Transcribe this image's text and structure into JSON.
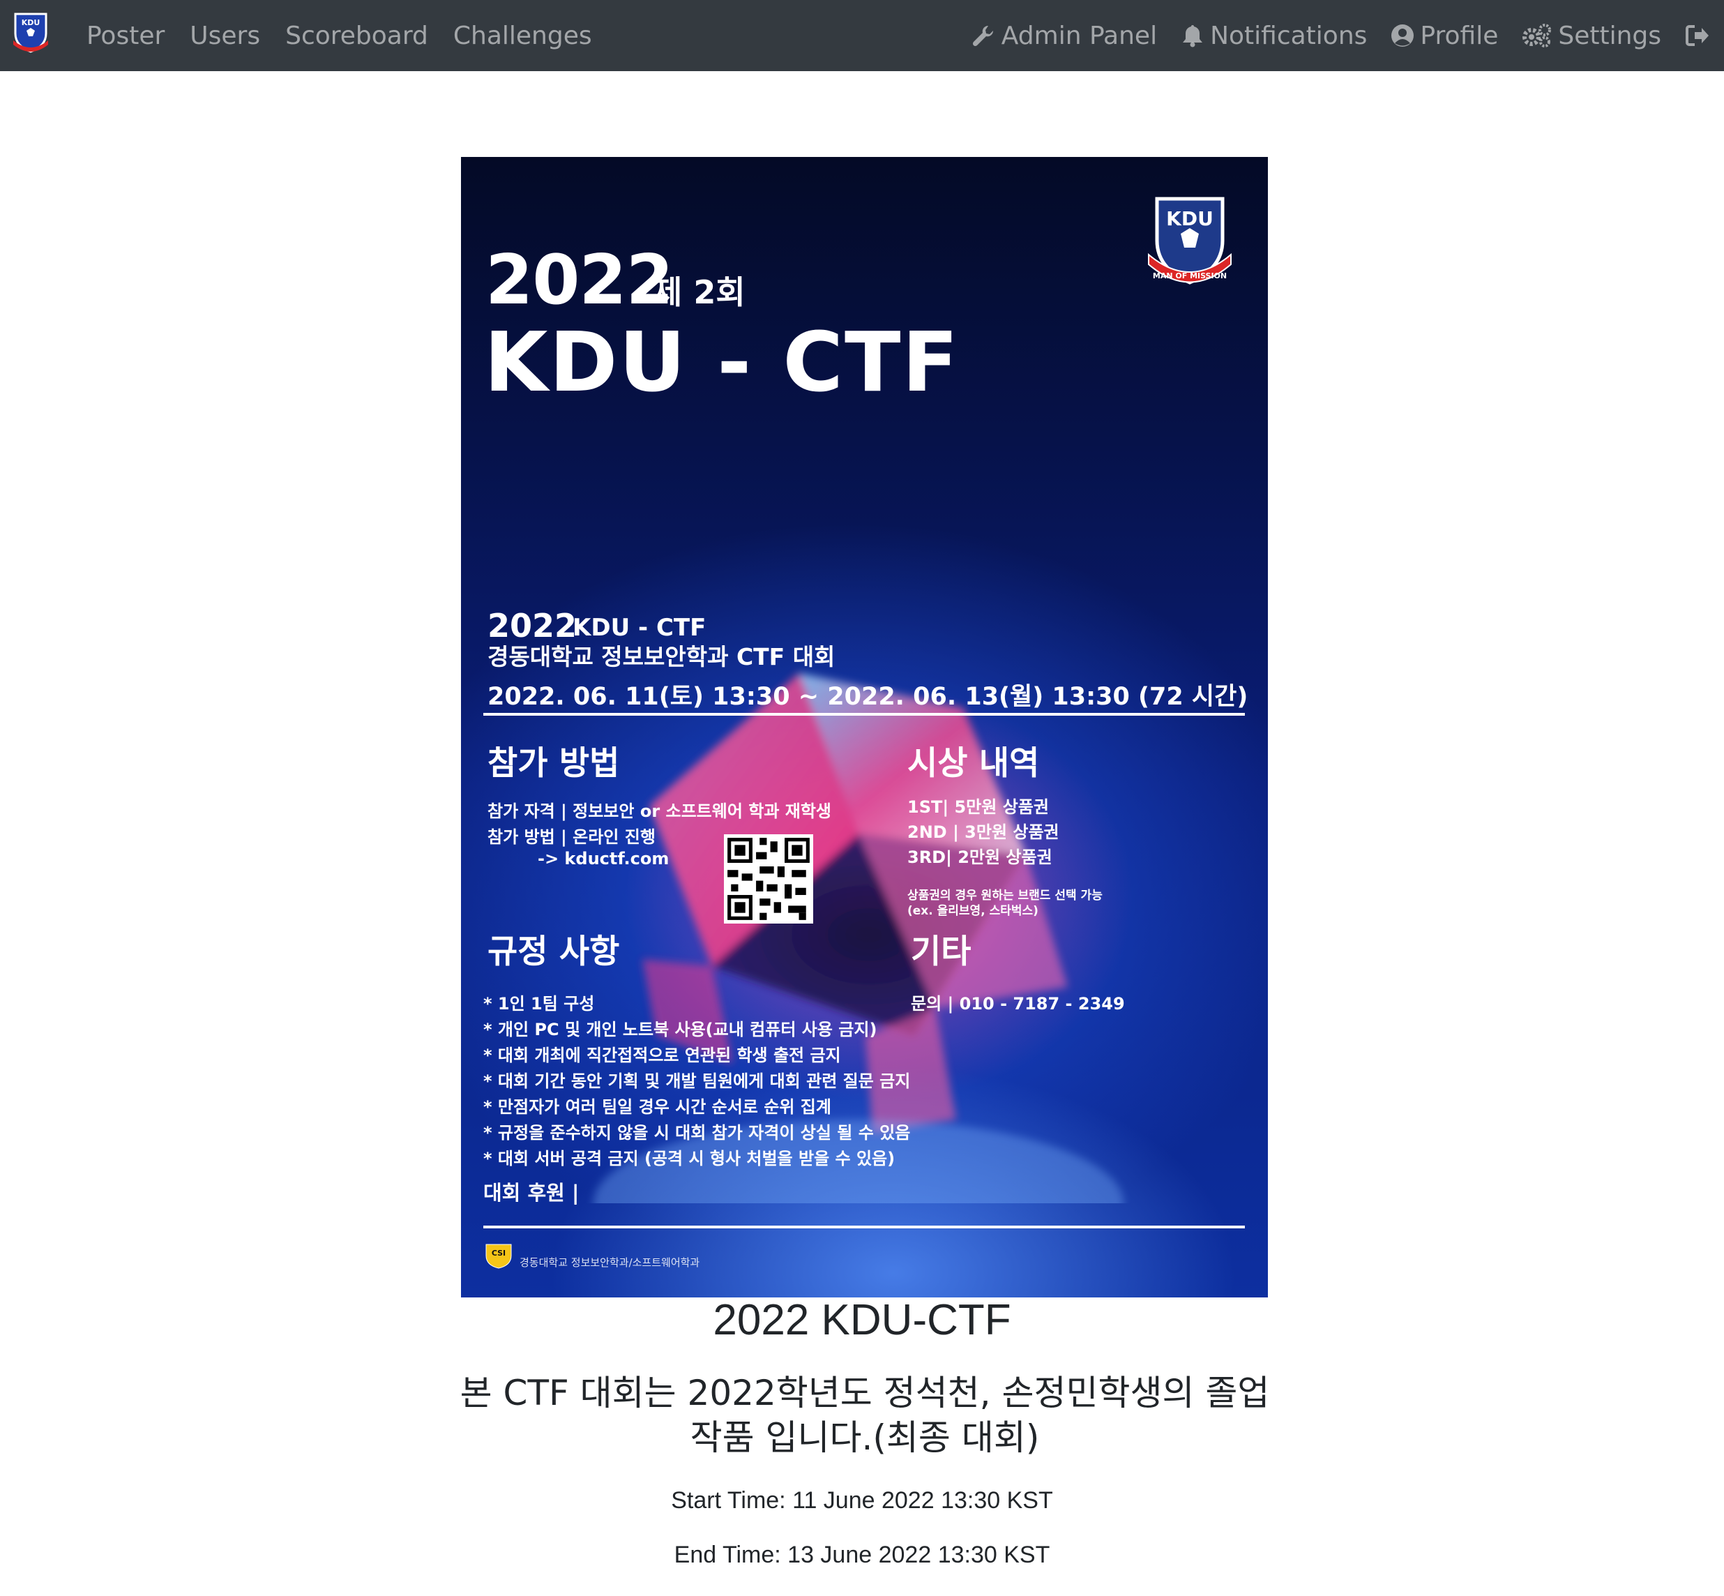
{
  "navbar": {
    "logo_text": "KDU",
    "left_links": [
      {
        "label": "Poster"
      },
      {
        "label": "Users"
      },
      {
        "label": "Scoreboard"
      },
      {
        "label": "Challenges"
      }
    ],
    "right_links": [
      {
        "label": "Admin Panel",
        "icon": "wrench-icon"
      },
      {
        "label": "Notifications",
        "icon": "bell-icon"
      },
      {
        "label": "Profile",
        "icon": "user-circle-icon"
      },
      {
        "label": "Settings",
        "icon": "gears-icon"
      }
    ],
    "logout_icon": "sign-out-icon"
  },
  "poster": {
    "year": "2022",
    "round": "제 2회",
    "title": "KDU - CTF",
    "badge_text": "KDU",
    "badge_motto": "MAN OF MISSION",
    "subtitle_year": "2022",
    "subtitle_name": "KDU - CTF",
    "subtitle_dept": "경동대학교 정보보안학과 CTF 대회",
    "dates": "2022. 06. 11(토) 13:30 ~ 2022. 06. 13(월) 13:30 (72 시간)",
    "participation": {
      "heading": "참가 방법",
      "lines": [
        "참가 자격 | 정보보안 or 소프트웨어 학과 재학생",
        "참가 방법 | 온라인 진행",
        "-> kductf.com"
      ]
    },
    "awards": {
      "heading": "시상 내역",
      "lines": [
        "1ST| 5만원 상품권",
        "2ND | 3만원 상품권",
        "3RD| 2만원 상품권"
      ],
      "note1": "상품권의 경우 원하는 브랜드 선택 가능",
      "note2": "(ex. 올리브영, 스타벅스)"
    },
    "rules": {
      "heading": "규정 사항",
      "lines": [
        "* 1인 1팀 구성",
        "* 개인 PC 및 개인 노트북 사용(교내 컴퓨터 사용 금지)",
        "* 대회 개최에 직간접적으로 연관된 학생 출전 금지",
        "* 대회 기간 동안 기획 및 개발 팀원에게 대회 관련 질문 금지",
        "* 만점자가 여러 팀일 경우 시간 순서로 순위 집계",
        "* 규정을 준수하지 않을 시 대회 참가 자격이 상실 될 수 있음",
        "* 대회 서버 공격 금지 (공격 시 형사 처벌을 받을 수 있음)"
      ]
    },
    "etc": {
      "heading": "기타",
      "contact": "문의 | 010 - 7187 - 2349"
    },
    "sponsor": "대회 후원  |",
    "footer_logo_text": "CSI",
    "footer_org": "경동대학교 정보보안학과/소프트웨어학과"
  },
  "content": {
    "ctf_name": "2022 KDU-CTF",
    "description": "본 CTF 대회는 2022학년도 정석천, 손정민학생의 졸업 작품 입니다.(최종 대회)",
    "start_time": "Start Time: 11 June 2022 13:30 KST",
    "end_time": "End Time: 13 June 2022 13:30 KST"
  }
}
